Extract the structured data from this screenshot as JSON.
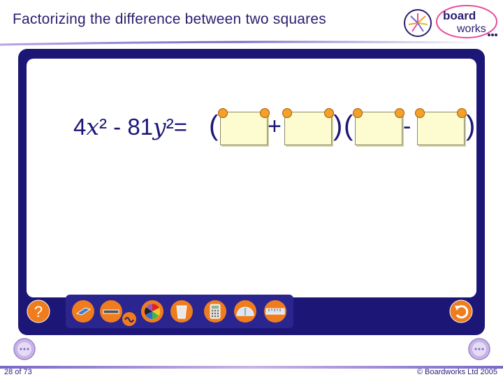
{
  "header": {
    "title": "Factorizing the difference between two squares",
    "logo_text_top": "board",
    "logo_text_bottom": "works"
  },
  "equation": {
    "coef_a": "4",
    "var_a": "x",
    "exp": "²",
    "minus": " - ",
    "coef_b": "81",
    "var_b": "y",
    "equals": "=",
    "open_paren": "(",
    "close_paren": ")",
    "plus": "+",
    "minus_op": "-"
  },
  "answer_boxes": [
    {
      "value": ""
    },
    {
      "value": ""
    },
    {
      "value": ""
    },
    {
      "value": ""
    }
  ],
  "toolbar": {
    "help_icon": "question-icon",
    "help_label": "?",
    "tools": [
      "eraser-icon",
      "pen-icon",
      "color-wheel-icon",
      "bin-icon",
      "calculator-icon",
      "protractor-icon",
      "ruler-icon"
    ],
    "undo_icon": "undo-icon"
  },
  "footer": {
    "slide_count": "28 of 73",
    "copyright": "© Boardworks Ltd 2005"
  },
  "colors": {
    "board": "#1c1777",
    "tool_orange": "#ef7d1e",
    "note_fill": "#fdfbd0",
    "title": "#2a1e6e"
  }
}
